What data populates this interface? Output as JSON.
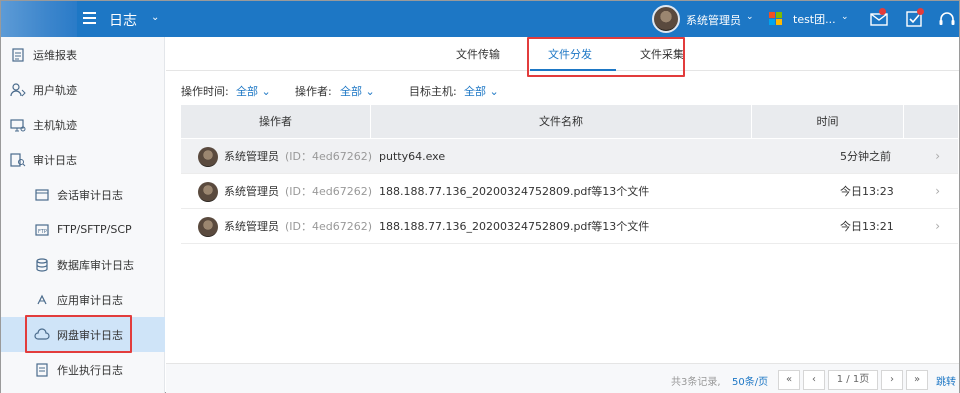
{
  "header": {
    "app_title": "日志",
    "user_name": "系统管理员",
    "org_name": "test团...",
    "brand_color": "#1d77c5",
    "icons": [
      "menu-icon",
      "mail-icon",
      "checklist-icon",
      "headset-icon"
    ]
  },
  "sidebar": {
    "items": [
      {
        "label": "运维报表",
        "icon": "report-icon"
      },
      {
        "label": "用户轨迹",
        "icon": "user-track-icon"
      },
      {
        "label": "主机轨迹",
        "icon": "host-track-icon"
      },
      {
        "label": "审计日志",
        "icon": "audit-icon"
      },
      {
        "label": "会话审计日志",
        "icon": "session-icon"
      },
      {
        "label": "FTP/SFTP/SCP",
        "icon": "ftp-icon"
      },
      {
        "label": "数据库审计日志",
        "icon": "database-icon"
      },
      {
        "label": "应用审计日志",
        "icon": "app-icon"
      },
      {
        "label": "网盘审计日志",
        "icon": "cloud-icon"
      },
      {
        "label": "作业执行日志",
        "icon": "job-icon"
      }
    ],
    "active_index": 8
  },
  "tabs": [
    {
      "label": "文件传输"
    },
    {
      "label": "文件分发"
    },
    {
      "label": "文件采集"
    }
  ],
  "filters": {
    "time_label": "操作时间:",
    "time_value": "全部",
    "operator_label": "操作者:",
    "operator_value": "全部",
    "host_label": "目标主机:",
    "host_value": "全部"
  },
  "table": {
    "columns": [
      "操作者",
      "文件名称",
      "时间"
    ],
    "rows": [
      {
        "operator": "系统管理员",
        "id": "(ID：4ed67262)",
        "file": "putty64.exe",
        "time": "5分钟之前"
      },
      {
        "operator": "系统管理员",
        "id": "(ID：4ed67262)",
        "file": "188.188.77.136_20200324752809.pdf等13个文件",
        "time": "今日13:23"
      },
      {
        "operator": "系统管理员",
        "id": "(ID：4ed67262)",
        "file": "188.188.77.136_20200324752809.pdf等13个文件",
        "time": "今日13:21"
      }
    ]
  },
  "pagination": {
    "total_text": "共3条记录,",
    "page_size": "50条/页",
    "first": "«",
    "prev": "‹",
    "page_info": "1 / 1页",
    "next": "›",
    "last": "»",
    "jump": "跳转"
  }
}
